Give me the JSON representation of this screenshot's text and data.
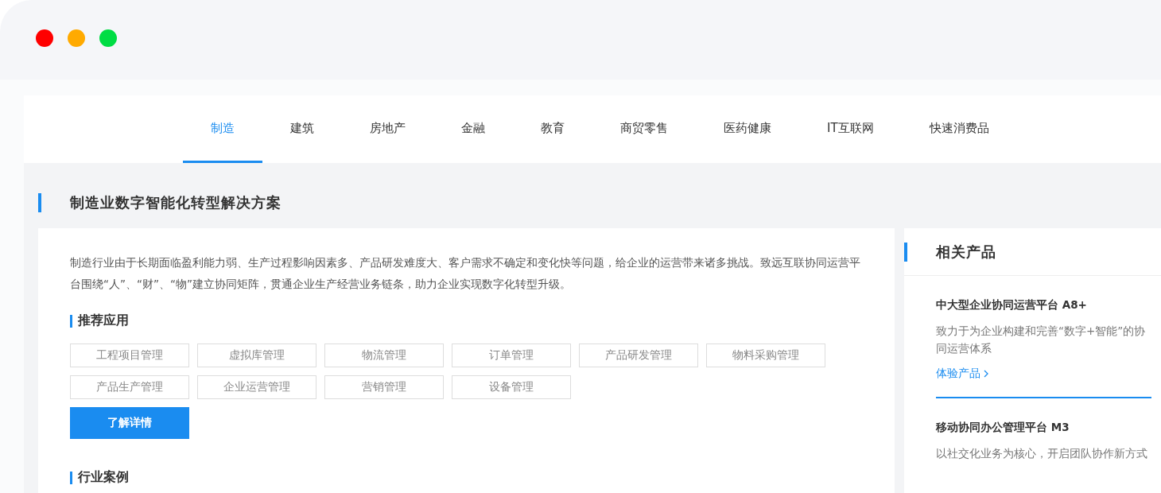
{
  "window": {
    "controls": [
      {
        "color": "#ff0000"
      },
      {
        "color": "#ffaa00"
      },
      {
        "color": "#00dd44"
      }
    ]
  },
  "tabs": [
    {
      "label": "制造",
      "selected": true
    },
    {
      "label": "建筑",
      "selected": false
    },
    {
      "label": "房地产",
      "selected": false
    },
    {
      "label": "金融",
      "selected": false
    },
    {
      "label": "教育",
      "selected": false
    },
    {
      "label": "商贸零售",
      "selected": false
    },
    {
      "label": "医药健康",
      "selected": false
    },
    {
      "label": "IT互联网",
      "selected": false
    },
    {
      "label": "快速消费品",
      "selected": false
    }
  ],
  "section_title": "制造业数字智能化转型解决方案",
  "intro": "制造行业由于长期面临盈利能力弱、生产过程影响因素多、产品研发难度大、客户需求不确定和变化快等问题，给企业的运营带来诸多挑战。致远互联协同运营平台围绕“人”、“财”、“物”建立协同矩阵，贯通企业生产经营业务链条，助力企业实现数字化转型升级。",
  "recommended": {
    "title": "推荐应用",
    "apps": [
      "工程项目管理",
      "虚拟库管理",
      "物流管理",
      "订单管理",
      "产品研发管理",
      "物料采购管理",
      "产品生产管理",
      "企业运营管理",
      "营销管理",
      "设备管理"
    ],
    "button": "了解详情"
  },
  "cases": {
    "title": "行业案例"
  },
  "related": {
    "title": "相关产品",
    "products": [
      {
        "name": "中大型企业协同运营平台 A8+",
        "desc": "致力于为企业构建和完善“数字+智能”的协同运营体系",
        "link": "体验产品",
        "selected": true
      },
      {
        "name": "移动协同办公管理平台 M3",
        "desc": "以社交化业务为核心，开启团队协作新方式",
        "selected": false
      }
    ]
  }
}
